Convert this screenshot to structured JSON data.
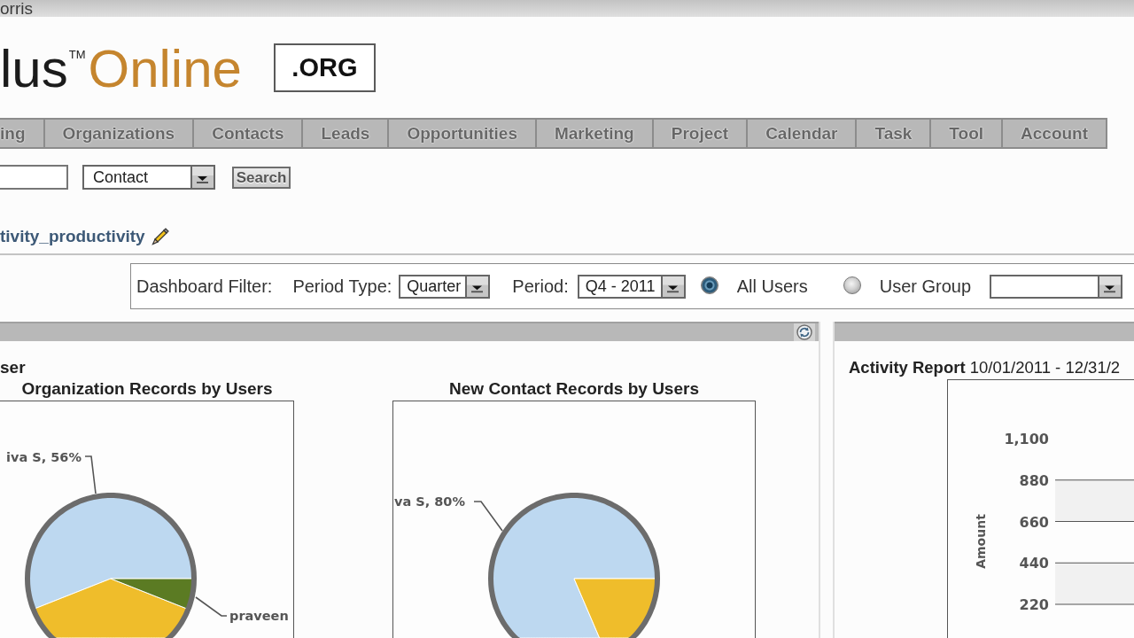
{
  "top_bar": {
    "user_name": "orris"
  },
  "header": {
    "logo": "lus$^{TM}$",
    "logo_accent": "Online",
    "edition": ".ORG"
  },
  "tabs": [
    {
      "label": "ing",
      "selected": false
    },
    {
      "label": "Organizations",
      "selected": false
    },
    {
      "label": "Contacts",
      "selected": false
    },
    {
      "label": "Leads",
      "selected": false
    },
    {
      "label": "Opportunities",
      "selected": false
    },
    {
      "label": "Marketing",
      "selected": false
    },
    {
      "label": "Project",
      "selected": false
    },
    {
      "label": "Calendar",
      "selected": false
    },
    {
      "label": "Task",
      "selected": false
    },
    {
      "label": "Tool",
      "selected": false
    },
    {
      "label": "Account",
      "selected": false
    }
  ],
  "search": {
    "module": "Contact",
    "button": "Search"
  },
  "dashboard": {
    "name": "tivity_productivity"
  },
  "filter": {
    "title": "Dashboard Filter:",
    "period_type": {
      "label": "Period Type:",
      "value": "Quarter"
    },
    "period": {
      "label": "Period:",
      "value": "Q4 - 2011"
    },
    "scopes": [
      {
        "label": "All Users",
        "selected": true
      },
      {
        "label": "User Group",
        "selected": false
      }
    ]
  },
  "records_panel": {
    "title": "ser",
    "pies": [
      {
        "title": "Organization Records by Users",
        "labels": [
          {
            "text": "iva S, 56%"
          },
          {
            "text": "praveen"
          }
        ]
      },
      {
        "title": "New Contact Records by Users",
        "labels": [
          {
            "text": "va S, 80%"
          }
        ]
      }
    ]
  },
  "activity_panel": {
    "title": "**Activity Report** 10/01/2011 - 12/31/2",
    "chart_data": {
      "type": "bar",
      "ylabel": "Amount",
      "categories": [
        null
      ],
      "ylim": [
        220,
        1100
      ],
      "grid": true,
      "yticks": [
        {
          "value": 220,
          "label": "220"
        },
        {
          "value": 440,
          "label": "440"
        },
        {
          "value": 660,
          "label": "660"
        },
        {
          "value": 880,
          "label": "880"
        },
        {
          "value": 1100,
          "label": "1,100"
        }
      ]
    }
  }
}
